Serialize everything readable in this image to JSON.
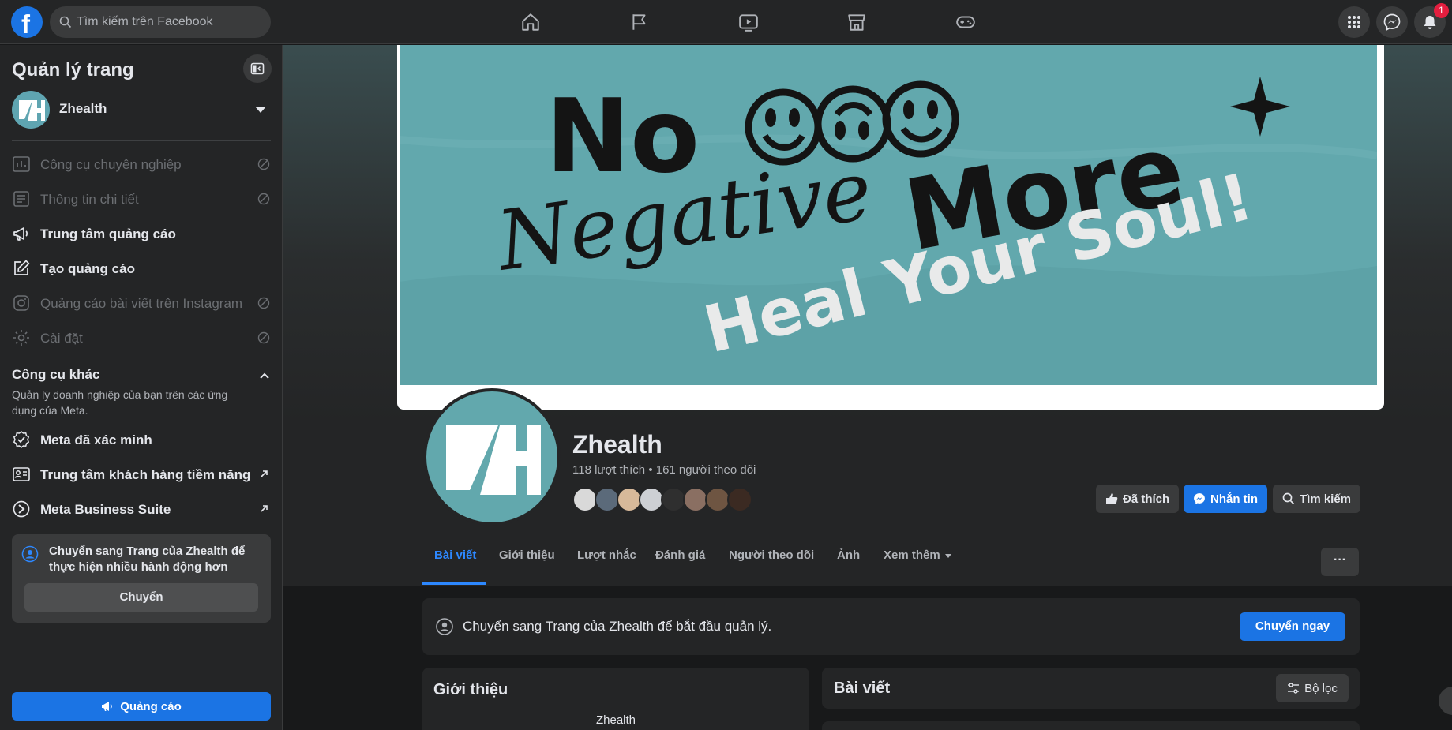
{
  "topbar": {
    "logo": "f",
    "search_placeholder": "Tìm kiếm trên Facebook",
    "nav_icons": [
      "home-icon",
      "flag-icon",
      "video-icon",
      "marketplace-icon",
      "gaming-icon"
    ],
    "notification_count": "1"
  },
  "sidebar": {
    "title": "Quản lý trang",
    "page_name": "Zhealth",
    "items": [
      {
        "label": "Công cụ chuyên nghiệp",
        "disabled": true
      },
      {
        "label": "Thông tin chi tiết",
        "disabled": true
      },
      {
        "label": "Trung tâm quảng cáo",
        "disabled": false
      },
      {
        "label": "Tạo quảng cáo",
        "disabled": false
      },
      {
        "label": "Quảng cáo bài viết trên Instagram",
        "disabled": true
      },
      {
        "label": "Cài đặt",
        "disabled": true
      }
    ],
    "other_tools": {
      "title": "Công cụ khác",
      "description": "Quản lý doanh nghiệp của bạn trên các ứng dụng của Meta.",
      "items": [
        {
          "label": "Meta đã xác minh"
        },
        {
          "label": "Trung tâm khách hàng tiềm năng"
        },
        {
          "label": "Meta Business Suite"
        }
      ]
    },
    "switch_card": {
      "text": "Chuyển sang Trang của Zhealth để thực hiện nhiều hành động hơn",
      "button": "Chuyển"
    },
    "ads_button": "Quảng cáo"
  },
  "cover": {
    "line1": "No",
    "line2": "More",
    "line3": "Negative",
    "line4": "Heal Your Soul!"
  },
  "profile": {
    "name": "Zhealth",
    "stats": "118 lượt thích • 161 người theo dõi",
    "buttons": {
      "liked": "Đã thích",
      "message": "Nhắn tin",
      "search": "Tìm kiếm"
    }
  },
  "tabs": [
    {
      "label": "Bài viết",
      "active": true
    },
    {
      "label": "Giới thiệu"
    },
    {
      "label": "Lượt nhắc"
    },
    {
      "label": "Đánh giá"
    },
    {
      "label": "Người theo dõi"
    },
    {
      "label": "Ảnh"
    },
    {
      "label": "Xem thêm"
    }
  ],
  "banner": {
    "text": "Chuyển sang Trang của Zhealth để bắt đầu quản lý.",
    "button": "Chuyển ngay"
  },
  "intro_card": {
    "title": "Giới thiệu",
    "subtitle": "Zhealth"
  },
  "posts_card": {
    "title": "Bài viết",
    "filter_button": "Bộ lọc"
  },
  "colors": {
    "accent": "#1b74e4",
    "link": "#2d88ff",
    "cover": "#62a8ad",
    "background": "#18191a",
    "surface": "#242526"
  }
}
